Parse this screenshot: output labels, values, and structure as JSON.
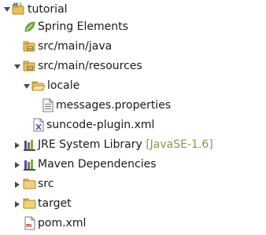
{
  "tree": {
    "project": {
      "label": "tutorial",
      "expanded": true,
      "icon": "maven-project-icon"
    },
    "spring_elements": {
      "label": "Spring Elements",
      "icon": "spring-leaf-icon"
    },
    "src_main_java": {
      "label": "src/main/java",
      "icon": "source-folder-icon"
    },
    "src_main_resources": {
      "label": "src/main/resources",
      "expanded": true,
      "icon": "source-folder-icon"
    },
    "locale": {
      "label": "locale",
      "expanded": true,
      "icon": "open-folder-icon"
    },
    "messages_properties": {
      "label": "messages.properties",
      "icon": "properties-file-icon"
    },
    "suncode_plugin_xml": {
      "label": "suncode-plugin.xml",
      "icon": "xml-file-icon"
    },
    "jre_library": {
      "label": "JRE System Library",
      "decoration": "[JavaSE-1.6]",
      "expanded": false,
      "icon": "library-icon"
    },
    "maven_dependencies": {
      "label": "Maven Dependencies",
      "expanded": false,
      "icon": "library-icon"
    },
    "src": {
      "label": "src",
      "expanded": false,
      "icon": "folder-icon"
    },
    "target": {
      "label": "target",
      "expanded": false,
      "icon": "folder-icon"
    },
    "pom_xml": {
      "label": "pom.xml",
      "icon": "pom-file-icon"
    }
  },
  "colors": {
    "decoration": "#958f4e",
    "folder": "#e8c15a",
    "folder_dark": "#b08a2a",
    "spring": "#6db33f",
    "twisty": "#4a4a4a"
  }
}
